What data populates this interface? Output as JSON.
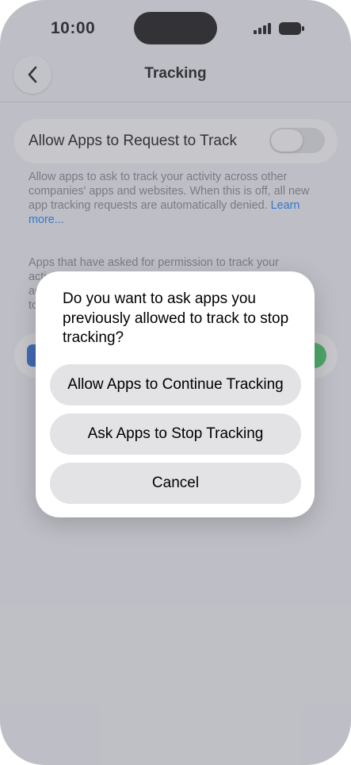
{
  "status_bar": {
    "time": "10:00"
  },
  "nav": {
    "title": "Tracking"
  },
  "setting": {
    "label": "Allow Apps to Request to Track",
    "toggle_on": false,
    "description": "Allow apps to ask to track your activity across other companies' apps and websites. When this is off, all new app tracking requests are automatically denied. ",
    "learn_more": "Learn more..."
  },
  "apps_section": {
    "description_visible": "Apps that have asked for permission to track your\nacti\nac\nto"
  },
  "alert": {
    "message": "Do you want to ask apps you previously allowed to track to stop tracking?",
    "buttons": [
      "Allow Apps to Continue Tracking",
      "Ask Apps to Stop Tracking",
      "Cancel"
    ]
  },
  "colors": {
    "accent": "#007aff",
    "toggle_on": "#34c759"
  }
}
